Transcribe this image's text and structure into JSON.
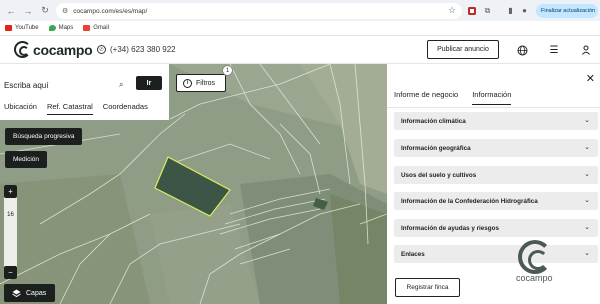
{
  "browser": {
    "url": "cocampo.com/es/es/map/",
    "update_label": "Finalizar actualización",
    "bookmarks": [
      {
        "label": "YouTube",
        "color": "#e62117"
      },
      {
        "label": "Maps",
        "color": "#34a853"
      },
      {
        "label": "Gmail",
        "color": "#ea4335"
      }
    ]
  },
  "header": {
    "logo_text": "cocampo",
    "phone": "(+34) 623 380 922",
    "publish_label": "Publicar anuncio"
  },
  "search": {
    "placeholder": "Escriba aquí",
    "go_label": "Ir",
    "tabs": [
      "Ubicación",
      "Ref. Catastral",
      "Coordenadas"
    ],
    "active_tab": 1
  },
  "map": {
    "filters_label": "Filtros",
    "filters_count": "1",
    "progressive_search_label": "Búsqueda progresiva",
    "measure_label": "Medición",
    "zoom_in": "+",
    "zoom_out": "−",
    "zoom_level": "16",
    "layers_label": "Capas"
  },
  "panel": {
    "tabs": [
      "Informe de negocio",
      "Información"
    ],
    "active_tab": 1,
    "sections": [
      "Información climática",
      "Información geográfica",
      "Usos del suelo y cultivos",
      "Información de la Confederación Hidrográfica",
      "Información de ayudas y riesgos",
      "Enlaces"
    ],
    "register_label": "Registrar finca",
    "watermark_text": "cocampo"
  },
  "colors": {
    "primary_dark": "#1b1f1d",
    "selected_parcel": "#3c5546",
    "selected_border": "#d6f05a"
  }
}
